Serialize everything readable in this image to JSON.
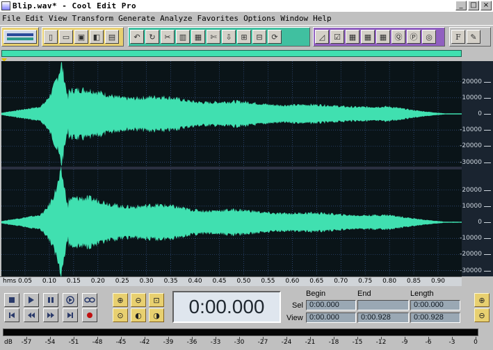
{
  "window": {
    "title": "Blip.wav* - Cool Edit Pro",
    "controls": [
      "_",
      "□",
      "×"
    ]
  },
  "menu": [
    "File",
    "Edit",
    "View",
    "Transform",
    "Generate",
    "Analyze",
    "Favorites",
    "Options",
    "Window",
    "Help"
  ],
  "toolbar": {
    "groups": [
      {
        "name": "mode",
        "icons": [
          "multitrack-toggle-icon"
        ],
        "color": "#e8d070"
      },
      {
        "name": "file",
        "icons": [
          "new-file-icon",
          "open-file-icon",
          "save-icon",
          "save-all-icon",
          "close-file-icon"
        ],
        "color": "#e8d070"
      },
      {
        "name": "edit",
        "icons": [
          "undo-icon",
          "repeat-icon",
          "cut-icon-1",
          "copy-icon",
          "paste-icon",
          "scissors-icon",
          "mix-paste-icon",
          "trim-icon",
          "snap-icon",
          "loop-icon"
        ],
        "color": "#40c0a0"
      },
      {
        "name": "analyze",
        "icons": [
          "envelope-icon",
          "check-icon",
          "grid-icon-1",
          "grid-icon-2",
          "grid-icon-3",
          "zoom-view-icon",
          "properties-icon",
          "cd-icon"
        ],
        "color": "#9060c0"
      },
      {
        "name": "misc",
        "icons": [
          "font-icon",
          "script-icon"
        ],
        "color": "#c0c0c0"
      }
    ]
  },
  "colors": {
    "waveform": "#40e0b0",
    "waveform_bg": "#0a1418",
    "grid": "#4060a0",
    "accent_yellow": "#e8d070"
  },
  "amplitude_ruler": {
    "labels": [
      "20000",
      "10000",
      "0",
      "-10000",
      "-20000",
      "-30000"
    ]
  },
  "time_ruler": {
    "unit": "hms",
    "labels": [
      "0.05",
      "0.10",
      "0.15",
      "0.20",
      "0.25",
      "0.30",
      "0.35",
      "0.40",
      "0.45",
      "0.50",
      "0.55",
      "0.60",
      "0.65",
      "0.70",
      "0.75",
      "0.80",
      "0.85",
      "0.90"
    ]
  },
  "transport": {
    "buttons": [
      "stop-icon",
      "play-icon",
      "pause-icon",
      "play-looped-icon",
      "loop-icon",
      "goto-start-icon",
      "rewind-icon",
      "fast-forward-icon",
      "goto-end-icon",
      "record-icon"
    ]
  },
  "zoom": {
    "buttons": [
      "zoom-in-horizontal-icon",
      "zoom-out-horizontal-icon",
      "zoom-full-icon",
      "zoom-selection-icon",
      "zoom-left-icon",
      "zoom-right-icon",
      "zoom-in-vertical-icon",
      "zoom-out-vertical-icon"
    ]
  },
  "time_display": "0:00.000",
  "selection": {
    "headers": {
      "begin": "Begin",
      "end": "End",
      "length": "Length"
    },
    "sel_label": "Sel",
    "view_label": "View",
    "sel": {
      "begin": "0:00.000",
      "end": "",
      "length": "0:00.000"
    },
    "view": {
      "begin": "0:00.000",
      "end": "0:00.928",
      "length": "0:00.928"
    }
  },
  "level_meter": {
    "unit": "dB",
    "labels": [
      "-57",
      "-54",
      "-51",
      "-48",
      "-45",
      "-42",
      "-39",
      "-36",
      "-33",
      "-30",
      "-27",
      "-24",
      "-21",
      "-18",
      "-15",
      "-12",
      "-9",
      "-6",
      "-3",
      "0"
    ]
  }
}
